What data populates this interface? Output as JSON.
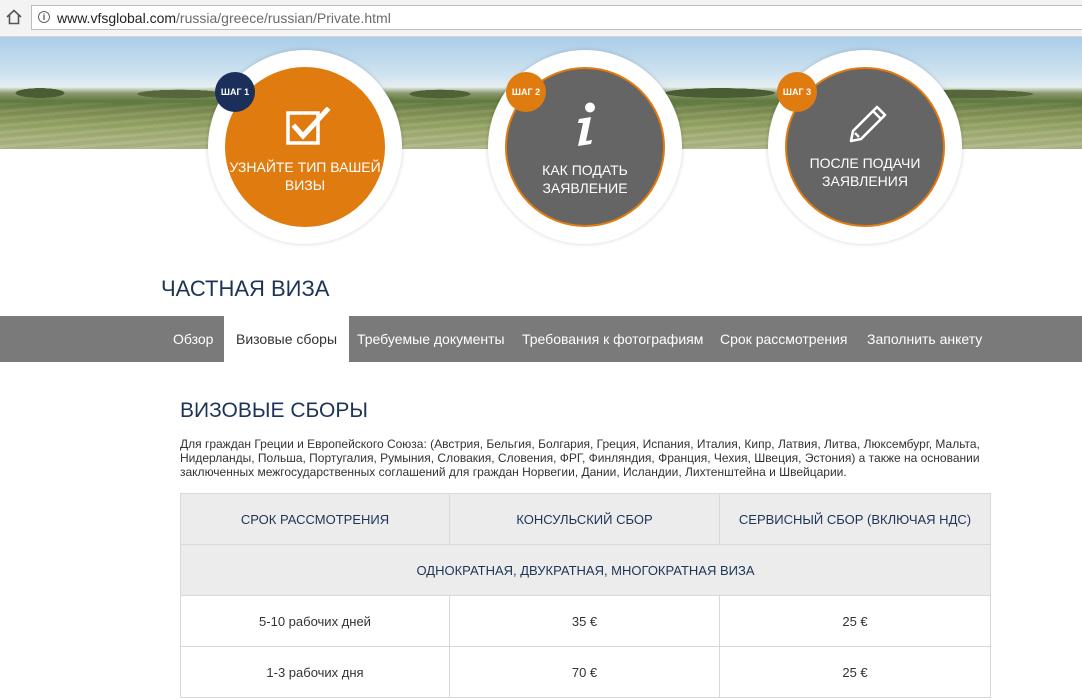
{
  "browser": {
    "url_host": "www.vfsglobal.com",
    "url_path": "/russia/greece/russian/Private.html"
  },
  "steps": [
    {
      "badge": "ШАГ 1",
      "label": "УЗНАЙТЕ ТИП ВАШЕЙ ВИЗЫ",
      "icon": "checkbox-icon",
      "color": "#e07b10",
      "badge_color": "#1a2f5a"
    },
    {
      "badge": "ШАГ 2",
      "label": "КАК ПОДАТЬ ЗАЯВЛЕНИЕ",
      "icon": "info-icon",
      "color": "#656565",
      "badge_color": "#e07b10"
    },
    {
      "badge": "ШАГ 3",
      "label": "ПОСЛЕ ПОДАЧИ ЗАЯВЛЕНИЯ",
      "icon": "pencil-icon",
      "color": "#656565",
      "badge_color": "#e07b10"
    }
  ],
  "page_title": "ЧАСТНАЯ ВИЗА",
  "tabs": [
    {
      "label": "Обзор",
      "active": false
    },
    {
      "label": "Визовые сборы",
      "active": true
    },
    {
      "label": "Требуемые документы",
      "active": false
    },
    {
      "label": "Требования к фотографиям",
      "active": false
    },
    {
      "label": "Срок рассмотрения",
      "active": false
    },
    {
      "label": "Заполнить анкету",
      "active": false
    }
  ],
  "section": {
    "title": "ВИЗОВЫЕ СБОРЫ",
    "intro": "Для граждан Греции и Европейского Союза: (Австрия, Бельгия, Болгария, Греция, Испания, Италия, Кипр, Латвия, Литва, Люксембург, Мальта, Нидерланды, Польша, Португалия, Румыния, Словакия, Словения, ФРГ, Финляндия, Франция, Чехия, Швеция, Эстония) а также на основании заключенных межгосударственных соглашений для граждан Норвегии, Дании, Исландии, Лихтенштейна и Швейцарии."
  },
  "fee_table": {
    "headers": [
      "СРОК РАССМОТРЕНИЯ",
      "КОНСУЛЬСКИЙ СБОР",
      "СЕРВИСНЫЙ СБОР (ВКЛЮЧАЯ НДС)"
    ],
    "group_label": "ОДНОКРАТНАЯ, ДВУКРАТНАЯ, МНОГОКРАТНАЯ ВИЗА",
    "rows": [
      [
        "5-10  рабочих дней",
        "35 €",
        "25 €"
      ],
      [
        "1-3 рабочих дня",
        "70 €",
        "25 €"
      ]
    ]
  },
  "colors": {
    "accent_orange": "#e07b10",
    "navy": "#1d3457",
    "nav_grey": "#7a7a7a"
  }
}
